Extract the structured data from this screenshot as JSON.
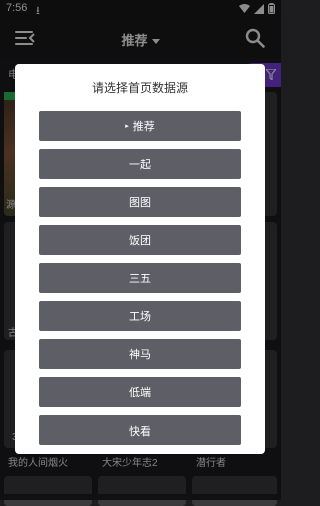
{
  "status_bar": {
    "time": "7:56",
    "download_icon": "download-icon",
    "wifi_icon": "wifi-icon",
    "signal_icon": "signal-icon",
    "battery_icon": "battery-icon"
  },
  "header": {
    "menu_icon": "menu-collapse-icon",
    "title": "推荐",
    "search_icon": "search-icon"
  },
  "tabs": {
    "left_label": "电",
    "filter_icon": "filter-icon",
    "accent_color": "#7b3fe4"
  },
  "background_cards": {
    "row1_caption": "源",
    "row2_caption": "古",
    "row3_badge": "3",
    "captions": [
      "我的人间烟火",
      "大宋少年志2",
      "潜行者"
    ]
  },
  "dialog": {
    "title": "请选择首页数据源",
    "selected_marker": "▸",
    "options": [
      "推荐",
      "一起",
      "图图",
      "饭团",
      "三五",
      "工场",
      "神马",
      "低端",
      "快看"
    ]
  }
}
